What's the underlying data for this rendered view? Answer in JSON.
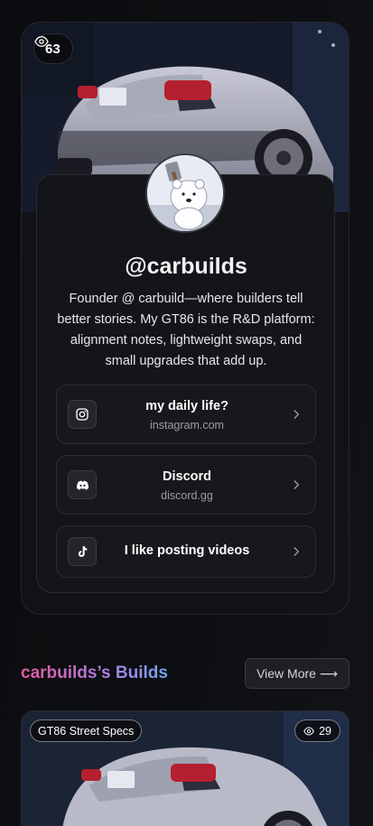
{
  "profile": {
    "view_count": "63",
    "handle": "@carbuilds",
    "bio": "Founder @ carbuild—where builders tell better stories. My GT86 is the R&D platform: alignment notes, lightweight swaps, and small upgrades that add up."
  },
  "links": [
    {
      "title": "my daily life?",
      "subtitle": "instagram.com",
      "icon": "instagram-icon"
    },
    {
      "title": "Discord",
      "subtitle": "discord.gg",
      "icon": "discord-icon"
    },
    {
      "title": "I like posting videos",
      "subtitle": "",
      "icon": "tiktok-icon"
    }
  ],
  "builds": {
    "section_title": "carbuilds’s Builds",
    "view_more_label": "View More ⟶",
    "items": [
      {
        "name": "GT86 Street Specs",
        "views": "29"
      }
    ]
  },
  "colors": {
    "title_gradient_start": "#e25aa0",
    "title_gradient_end": "#6fa8f0",
    "background": "#0e0f12"
  }
}
